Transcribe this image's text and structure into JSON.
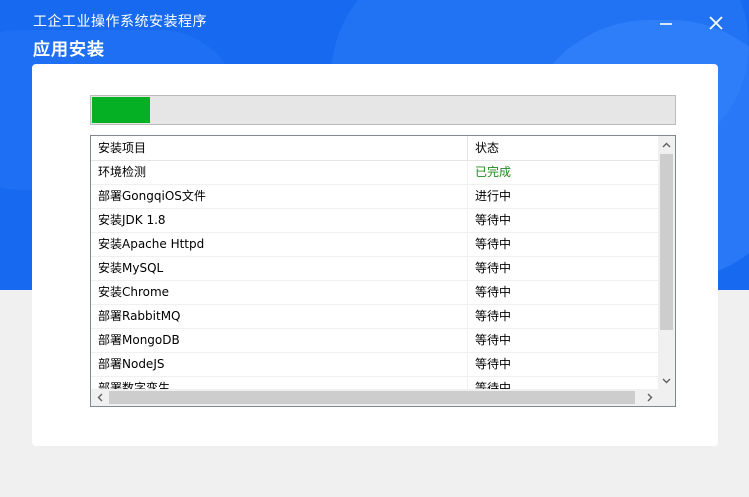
{
  "window": {
    "app_title": "工企工业操作系统安装程序",
    "page_title": "应用安装"
  },
  "progress": {
    "fraction": 0.1,
    "color": "#06b025"
  },
  "listview": {
    "columns": [
      "安装项目",
      "状态"
    ],
    "rows": [
      {
        "name": "环境检测",
        "status": "已完成"
      },
      {
        "name": "部署GongqiOS文件",
        "status": "进行中"
      },
      {
        "name": "安装JDK 1.8",
        "status": "等待中"
      },
      {
        "name": "安装Apache Httpd",
        "status": "等待中"
      },
      {
        "name": "安装MySQL",
        "status": "等待中"
      },
      {
        "name": "安装Chrome",
        "status": "等待中"
      },
      {
        "name": "部署RabbitMQ",
        "status": "等待中"
      },
      {
        "name": "部署MongoDB",
        "status": "等待中"
      },
      {
        "name": "部署NodeJS",
        "status": "等待中"
      },
      {
        "name": "部署数字孪生",
        "status": "等待中"
      }
    ],
    "status_colors": {
      "已完成": "#1e8c1e",
      "进行中": "#000000",
      "等待中": "#000000"
    }
  },
  "icons": {
    "minimize": "minimize-icon",
    "close": "close-icon",
    "scroll_up": "chevron-up-icon",
    "scroll_down": "chevron-down-icon",
    "scroll_left": "chevron-left-icon",
    "scroll_right": "chevron-right-icon"
  },
  "colors": {
    "header_blue": "#1769f0",
    "panel_bg": "#ffffff"
  }
}
